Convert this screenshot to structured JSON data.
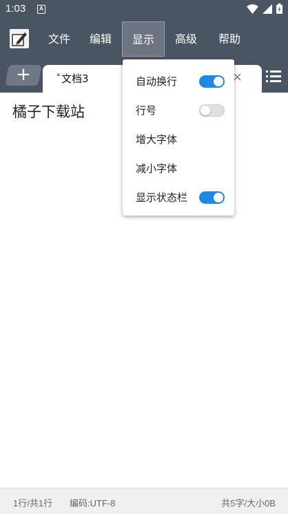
{
  "status_bar": {
    "time": "1:03",
    "notification_icon": "A"
  },
  "menu": {
    "items": [
      "文件",
      "编辑",
      "显示",
      "高级",
      "帮助"
    ],
    "active_index": 2
  },
  "tabs": {
    "add_label": "+",
    "active_tab": {
      "modified_marker": "*",
      "title": "文档3",
      "close_label": "×"
    }
  },
  "editor": {
    "content": "橘子下载站"
  },
  "display_menu": {
    "items": [
      {
        "label": "自动换行",
        "toggle": true
      },
      {
        "label": "行号",
        "toggle": false
      },
      {
        "label": "增大字体"
      },
      {
        "label": "减小字体"
      },
      {
        "label": "显示状态栏",
        "toggle": true
      }
    ]
  },
  "footer": {
    "position": "1行/共1行",
    "encoding": "编码:UTF-8",
    "stats": "共5字/大小0B"
  },
  "colors": {
    "toolbar": "#4a5563",
    "accent": "#1e88e5"
  }
}
